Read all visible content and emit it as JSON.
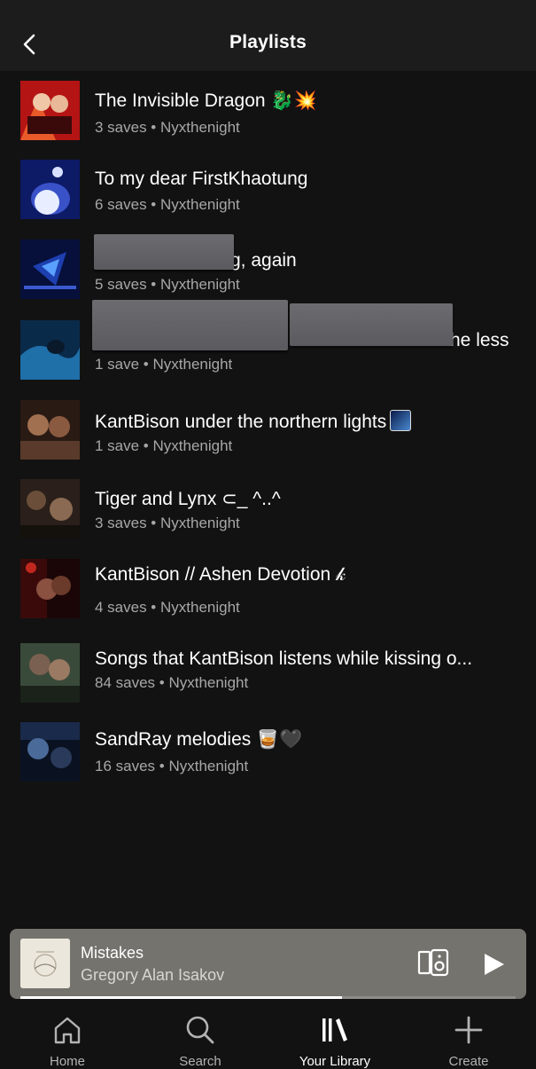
{
  "header": {
    "title": "Playlists"
  },
  "playlists": [
    {
      "title": "The Invisible Dragon 🐉💥",
      "subtitle": "3 saves • Nyxthenight",
      "cover": [
        "#b41414",
        "#e85a2a",
        "#3a0a0a"
      ]
    },
    {
      "title": "To my dear FirstKhaotung",
      "subtitle": "6 saves • Nyxthenight",
      "cover": [
        "#0d1a66",
        "#3a52c8",
        "#d8e0ff"
      ]
    },
    {
      "title": "g, again",
      "subtitle": "5 saves • Nyxthenight",
      "cover": [
        "#06103a",
        "#1d3fb0",
        "#5aa0ff"
      ]
    },
    {
      "title": "he less",
      "subtitle": "1 save • Nyxthenight",
      "cover": [
        "#0a2a4a",
        "#1f6fa8",
        "#0a1a2a"
      ]
    },
    {
      "title": "KantBison under the northern lights",
      "subtitle": "1 save • Nyxthenight",
      "cover": [
        "#5a3a2a",
        "#2a1a14",
        "#a07050"
      ]
    },
    {
      "title": "Tiger and Lynx ⊂_ ^..^",
      "subtitle": "3 saves • Nyxthenight",
      "cover": [
        "#2a1f1a",
        "#6a4e3a",
        "#14100c"
      ]
    },
    {
      "title": "KantBison // Ashen Devotion 𝓀",
      "subtitle": "4 saves • Nyxthenight",
      "cover": [
        "#3a0a0a",
        "#c0281e",
        "#1a0606"
      ]
    },
    {
      "title": "Songs that KantBison listens while kissing o...",
      "subtitle": "84 saves • Nyxthenight",
      "cover": [
        "#3a4a3a",
        "#7a8a7a",
        "#1a221a"
      ]
    },
    {
      "title": "SandRay melodies 🥃🖤",
      "subtitle": "16 saves • Nyxthenight",
      "cover": [
        "#1a2a4a",
        "#4a6a9a",
        "#0a1222"
      ]
    }
  ],
  "now_playing": {
    "title": "Mistakes",
    "artist": "Gregory Alan Isakov",
    "progress": 0.65
  },
  "nav": {
    "home": "Home",
    "search": "Search",
    "library": "Your Library",
    "create": "Create"
  },
  "colors": {
    "background": "#121212",
    "header": "#1c1c1c",
    "subtext": "#a7a7a7",
    "mini_player": "#74736e"
  }
}
